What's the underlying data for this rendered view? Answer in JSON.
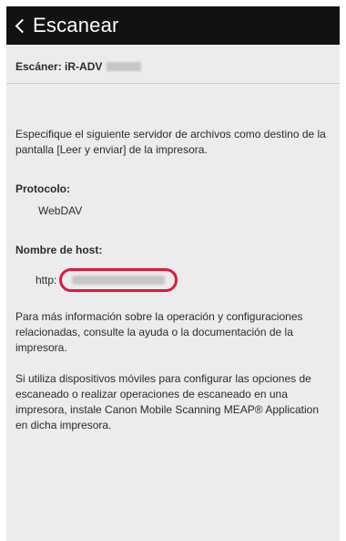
{
  "header": {
    "back_icon": "chevron-left-icon",
    "title": "Escanear"
  },
  "scanner": {
    "label": "Escáner: iR-ADV"
  },
  "intro_text": "Especifique el siguiente servidor de archivos como destino de la pantalla [Leer y enviar] de la impresora.",
  "protocol": {
    "label": "Protocolo:",
    "value": "WebDAV"
  },
  "host": {
    "label": "Nombre de host:",
    "prefix": "http:",
    "highlight_color": "#e3173d"
  },
  "info_text": "Para más información sobre la operación y configuraciones relacionadas, consulte la ayuda o la documentación de la impresora.",
  "mobile_text": "Si utiliza dispositivos móviles para configurar las opciones de escaneado o realizar operaciones de escaneado en una impresora, instale Canon Mobile Scanning MEAP® Application en dicha impresora."
}
